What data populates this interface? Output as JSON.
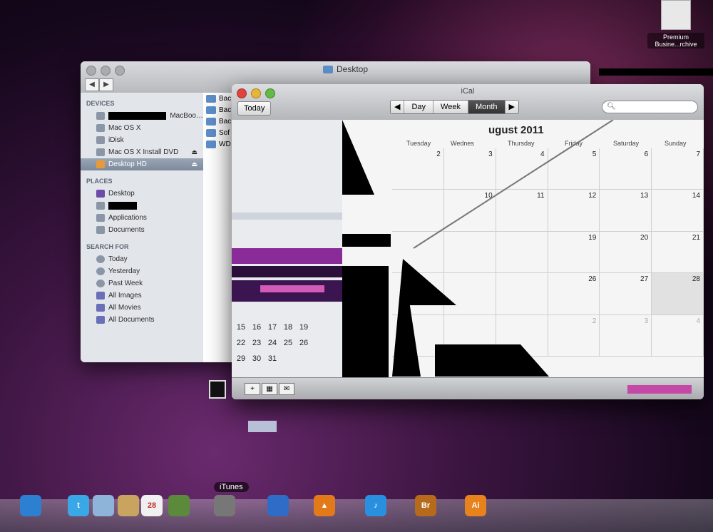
{
  "finder": {
    "title": "Desktop",
    "sidebar": {
      "devices_header": "DEVICES",
      "devices": [
        {
          "label": "MacBoo…",
          "icon": "laptop-icon"
        },
        {
          "label": "Mac OS X",
          "icon": "harddisk-icon"
        },
        {
          "label": "iDisk",
          "icon": "idisk-icon"
        },
        {
          "label": "Mac OS X Install DVD",
          "icon": "dvd-icon"
        },
        {
          "label": "Desktop HD",
          "icon": "harddisk-icon"
        }
      ],
      "places_header": "PLACES",
      "places": [
        {
          "label": "Desktop",
          "icon": "desktop-icon"
        },
        {
          "label": "",
          "icon": "home-icon"
        },
        {
          "label": "Applications",
          "icon": "applications-icon"
        },
        {
          "label": "Documents",
          "icon": "documents-icon"
        }
      ],
      "search_header": "SEARCH FOR",
      "search": [
        {
          "label": "Today"
        },
        {
          "label": "Yesterday"
        },
        {
          "label": "Past Week"
        },
        {
          "label": "All Images"
        },
        {
          "label": "All Movies"
        },
        {
          "label": "All Documents"
        }
      ]
    },
    "files": [
      "Bac",
      "Bac",
      "Bac",
      "Sof",
      "WD"
    ]
  },
  "ical": {
    "title": "iCal",
    "today_label": "Today",
    "views": {
      "day": "Day",
      "week": "Week",
      "month": "Month"
    },
    "month_title": "ugust 2011",
    "day_headers": [
      "Tuesday",
      "Wednes",
      "Thursday",
      "Friday",
      "Saturday",
      "Sunday"
    ],
    "weeks": [
      [
        "2",
        "3",
        "4",
        "5",
        "6",
        "7"
      ],
      [
        "",
        "10",
        "11",
        "12",
        "13",
        "14"
      ],
      [
        "",
        "",
        "",
        "19",
        "20",
        "21"
      ],
      [
        "",
        "",
        "",
        "26",
        "27",
        "28"
      ],
      [
        "",
        "",
        "",
        "2",
        "3",
        "4"
      ]
    ],
    "mini_cal": [
      [
        "15",
        "16",
        "17",
        "18",
        "19"
      ],
      [
        "22",
        "23",
        "24",
        "25",
        "26"
      ],
      [
        "29",
        "30",
        "31"
      ]
    ],
    "bottom_buttons": [
      "+",
      "",
      "✉"
    ]
  },
  "desktop_icon": {
    "line1": "Premium",
    "line2": "Busine...rchive"
  },
  "dock": {
    "hover_label": "iTunes",
    "items": [
      {
        "name": "safari-icon",
        "glyph": "",
        "color": "#2c7fd1"
      },
      {
        "name": "twitter-icon",
        "glyph": "t",
        "color": "#3aa7e6"
      },
      {
        "name": "preview-icon",
        "glyph": "",
        "color": "#8fb4d9"
      },
      {
        "name": "contacts-icon",
        "glyph": "",
        "color": "#c9a45e"
      },
      {
        "name": "ical-icon",
        "glyph": "28",
        "color": "#f0f0f0"
      },
      {
        "name": "app-icon",
        "glyph": "",
        "color": "#5a8a3a"
      },
      {
        "name": "tools-icon",
        "glyph": "",
        "color": "#777"
      },
      {
        "name": "app-store-icon",
        "glyph": "",
        "color": "#2f6cc7"
      },
      {
        "name": "vlc-icon",
        "glyph": "▲",
        "color": "#e27a1a"
      },
      {
        "name": "itunes-icon",
        "glyph": "♪",
        "color": "#2990e0"
      },
      {
        "name": "bridge-icon",
        "glyph": "Br",
        "color": "#b86a1c"
      },
      {
        "name": "illustrator-icon",
        "glyph": "Ai",
        "color": "#e8821c"
      }
    ]
  }
}
